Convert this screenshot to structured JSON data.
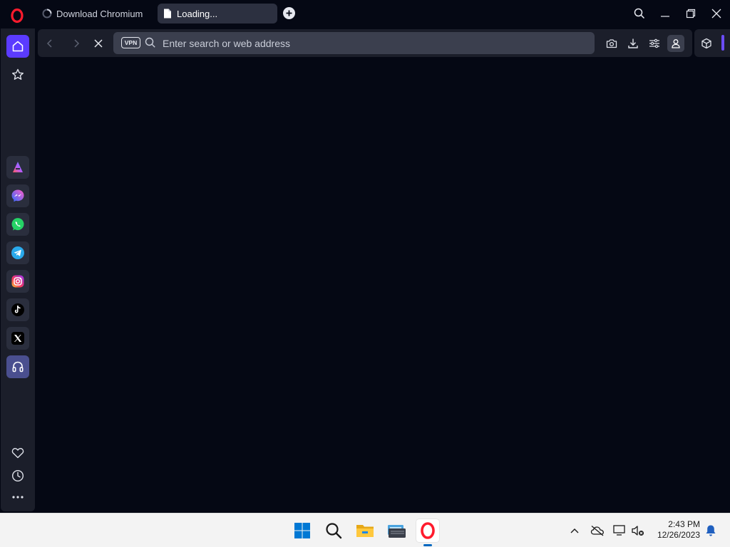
{
  "tabs": [
    {
      "label": "Download Chromium",
      "icon": "loading-spinner-icon",
      "active": false
    },
    {
      "label": "Loading...",
      "icon": "document-icon",
      "active": true
    }
  ],
  "address_bar": {
    "vpn_label": "VPN",
    "placeholder": "Enter search or web address",
    "value": ""
  },
  "sidebar": {
    "items": [
      {
        "name": "home",
        "icon": "home-icon"
      },
      {
        "name": "speed-dial",
        "icon": "star-icon"
      },
      {
        "name": "aria",
        "icon": "aria-icon"
      },
      {
        "name": "messenger",
        "icon": "messenger-icon"
      },
      {
        "name": "whatsapp",
        "icon": "whatsapp-icon"
      },
      {
        "name": "telegram",
        "icon": "telegram-icon"
      },
      {
        "name": "instagram",
        "icon": "instagram-icon"
      },
      {
        "name": "tiktok",
        "icon": "tiktok-icon"
      },
      {
        "name": "x",
        "icon": "x-icon"
      },
      {
        "name": "music-player",
        "icon": "headphones-icon"
      },
      {
        "name": "pinboards",
        "icon": "heart-icon"
      },
      {
        "name": "history",
        "icon": "clock-icon"
      },
      {
        "name": "more",
        "icon": "more-icon"
      }
    ]
  },
  "taskbar": {
    "time": "2:43 PM",
    "date": "12/26/2023"
  },
  "colors": {
    "accent": "#5b3bff",
    "opera_red": "#ff1b2d",
    "background": "#050814"
  }
}
